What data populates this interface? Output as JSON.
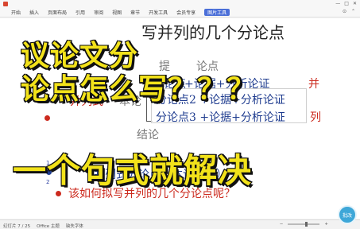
{
  "window": {
    "tab_label": "",
    "controls": [
      "—",
      "□",
      "✕"
    ]
  },
  "ribbon": {
    "menus": [
      "开始",
      "插入",
      "页面布局",
      "引用",
      "审阅",
      "视图",
      "章节",
      "开发工具",
      "会员专享"
    ],
    "active_tab": "图片工具",
    "right_items": [
      "⊙",
      "⌃"
    ]
  },
  "slide": {
    "title": "写并列的几个分论点",
    "frag_top_mid": "提",
    "frag_ti_suffix": "论点",
    "row1_left": "分论点",
    "row1_right": "+论据+分析论证",
    "row1_and": "并",
    "row2_left": "并列式",
    "row2_mid": "本论",
    "row2_box": "分论点2 +论据+分析论证",
    "row3_box": "分论点3 +论据+分析论证",
    "row3_tail": "列",
    "row4_frag": "结论",
    "num_tags": [
      "1",
      "2"
    ],
    "bottom_line1": "并列式分论点（本论部分）",
    "bottom_line2": "该如何拟写并列的几个分论点呢？"
  },
  "overlay": {
    "line1": "议论文分",
    "line2": "论点怎么写？？？",
    "line3": "一个句式就解决"
  },
  "status": {
    "left": [
      "幻灯片 7 / 25",
      "Office 主题",
      "缺失字体"
    ],
    "zoom": "",
    "floater_label": "批改"
  },
  "colors": {
    "accent": "#4b6fd8",
    "overlay_yellow": "#f2e21a",
    "bullet_red": "#cc2a1e",
    "bullet_navy": "#1f3c8f"
  }
}
